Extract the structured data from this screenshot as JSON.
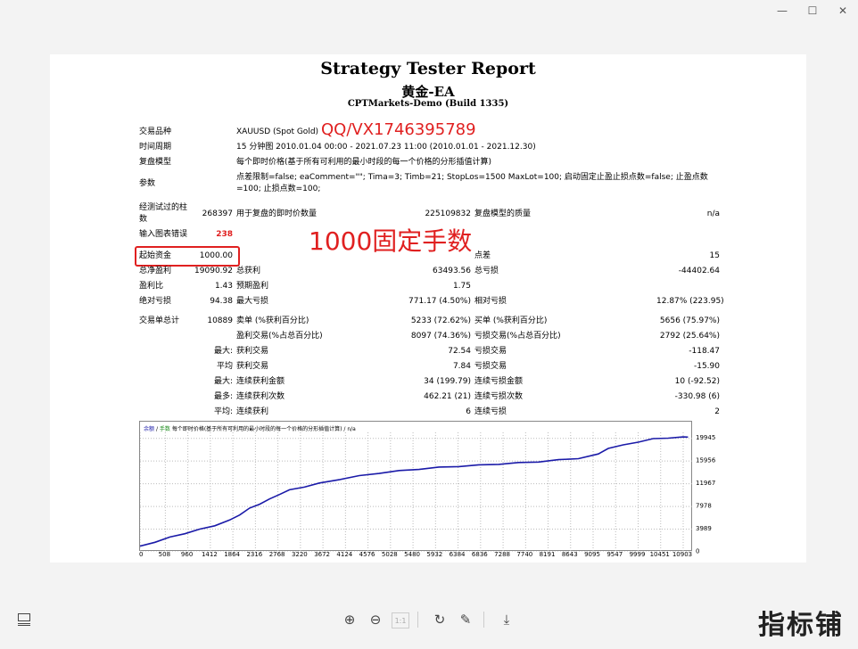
{
  "window": {
    "min": "—",
    "max": "☐",
    "close": "✕"
  },
  "report": {
    "title": "Strategy Tester Report",
    "ea_name": "黄金-EA",
    "server": "CPTMarkets-Demo (Build 1335)"
  },
  "info": {
    "symbol_label": "交易品种",
    "symbol_value": "XAUUSD (Spot Gold)",
    "watermark_contact": "QQ/VX1746395789",
    "period_label": "时间周期",
    "period_value": "15 分钟图 2010.01.04 00:00 - 2021.07.23 11:00 (2010.01.01 - 2021.12.30)",
    "model_label": "复盘模型",
    "model_value": "每个即时价格(基于所有可利用的最小时段的每一个价格的分形插值计算)",
    "params_label": "参数",
    "params_line1": "点差限制=false; eaComment=\"\"; Tima=3; Timb=21; StopLos=1500 MaxLot=100; 启动固定止盈止损点数=false; 止盈点数",
    "params_line2": "=100; 止损点数=100;"
  },
  "stats": {
    "bars_label1": "经测试过的柱",
    "bars_label2": "数",
    "bars_value": "268397",
    "ticks_label": "用于复盘的即时价数量",
    "ticks_value": "225109832",
    "quality_label": "复盘模型的质量",
    "quality_value": "n/a",
    "errors_label": "输入图表错误",
    "errors_value": "238",
    "lot_note": "1000固定手数",
    "deposit_label": "起始资金",
    "deposit_value": "1000.00",
    "spread_label": "点差",
    "spread_value": "15",
    "net_label": "总净盈利",
    "net_value": "19090.92",
    "gross_profit_label": "总获利",
    "gross_profit_value": "63493.56",
    "gross_loss_label": "总亏损",
    "gross_loss_value": "-44402.64",
    "pf_label": "盈利比",
    "pf_value": "1.43",
    "ep_label": "预期盈利",
    "ep_value": "1.75",
    "abs_dd_label": "绝对亏损",
    "abs_dd_value": "94.38",
    "max_dd_label": "最大亏损",
    "max_dd_value": "771.17 (4.50%)",
    "rel_dd_label": "相对亏损",
    "rel_dd_value": "12.87% (223.95)",
    "trades_label": "交易单总计",
    "trades_value": "10889",
    "short_label": "卖单 (%获利百分比)",
    "short_value": "5233 (72.62%)",
    "long_label": "买单 (%获利百分比)",
    "long_value": "5656 (75.97%)",
    "win_label": "盈利交易(%占总百分比)",
    "win_value": "8097 (74.36%)",
    "loss_label": "亏损交易(%占总百分比)",
    "loss_value": "2792 (25.64%)",
    "max_prefix": "最大:",
    "avg_prefix": "平均",
    "maxc_prefix": "最大:",
    "most_prefix": "最多:",
    "avgc_prefix": "平均:",
    "largest_win_label": "获利交易",
    "largest_win_value": "72.54",
    "largest_loss_label": "亏损交易",
    "largest_loss_value": "-118.47",
    "avg_win_label": "获利交易",
    "avg_win_value": "7.84",
    "avg_loss_label": "亏损交易",
    "avg_loss_value": "-15.90",
    "cw_amt_label": "连续获利金额",
    "cw_amt_value": "34 (199.79)",
    "cl_amt_label": "连续亏损金额",
    "cl_amt_value": "10 (-92.52)",
    "cw_cnt_label": "连续获利次数",
    "cw_cnt_value": "462.21 (21)",
    "cl_cnt_label": "连续亏损次数",
    "cl_cnt_value": "-330.98 (6)",
    "avg_cw_label": "连续获利",
    "avg_cw_value": "6",
    "avg_cl_label": "连续亏损",
    "avg_cl_value": "2"
  },
  "chart_header": {
    "balance": "余额",
    "slash": "/",
    "lots": "手数",
    "desc": "每个即时价格(基于所有可利用的最小时段的每一个价格的分形插值计算) / n/a"
  },
  "chart_data": {
    "type": "line",
    "y_ticks": [
      0,
      3989,
      7978,
      11967,
      15956,
      19945
    ],
    "x_ticks": [
      0,
      508,
      960,
      1412,
      1864,
      2316,
      2768,
      3220,
      3672,
      4124,
      4576,
      5028,
      5480,
      5932,
      6384,
      6836,
      7288,
      7740,
      8191,
      8643,
      9095,
      9547,
      9999,
      10451,
      10903
    ],
    "xlim": [
      0,
      11100
    ],
    "ylim": [
      0,
      21000
    ],
    "series": [
      {
        "color": "#1a1aa8",
        "x": [
          0,
          300,
          600,
          900,
          1200,
          1500,
          1800,
          2000,
          2200,
          2400,
          2600,
          2800,
          3000,
          3300,
          3600,
          4000,
          4400,
          4800,
          5200,
          5600,
          6000,
          6400,
          6800,
          7200,
          7600,
          8000,
          8400,
          8800,
          9200,
          9400,
          9700,
          10000,
          10300,
          10600,
          10900,
          11000
        ],
        "y": [
          1000,
          1800,
          2600,
          3300,
          4000,
          4700,
          5600,
          6600,
          7700,
          8500,
          9300,
          10200,
          10900,
          11500,
          12100,
          12800,
          13400,
          13900,
          14300,
          14600,
          14900,
          15100,
          15300,
          15500,
          15700,
          15900,
          16200,
          16500,
          17200,
          18300,
          18800,
          19400,
          19900,
          20100,
          20200,
          20300
        ]
      }
    ]
  },
  "toolbar": {
    "zoom_in": "⊕",
    "zoom_out": "⊖",
    "page": "1:1",
    "rotate": "↻",
    "edit": "✎",
    "download": "⤓"
  },
  "brand": "指标铺"
}
